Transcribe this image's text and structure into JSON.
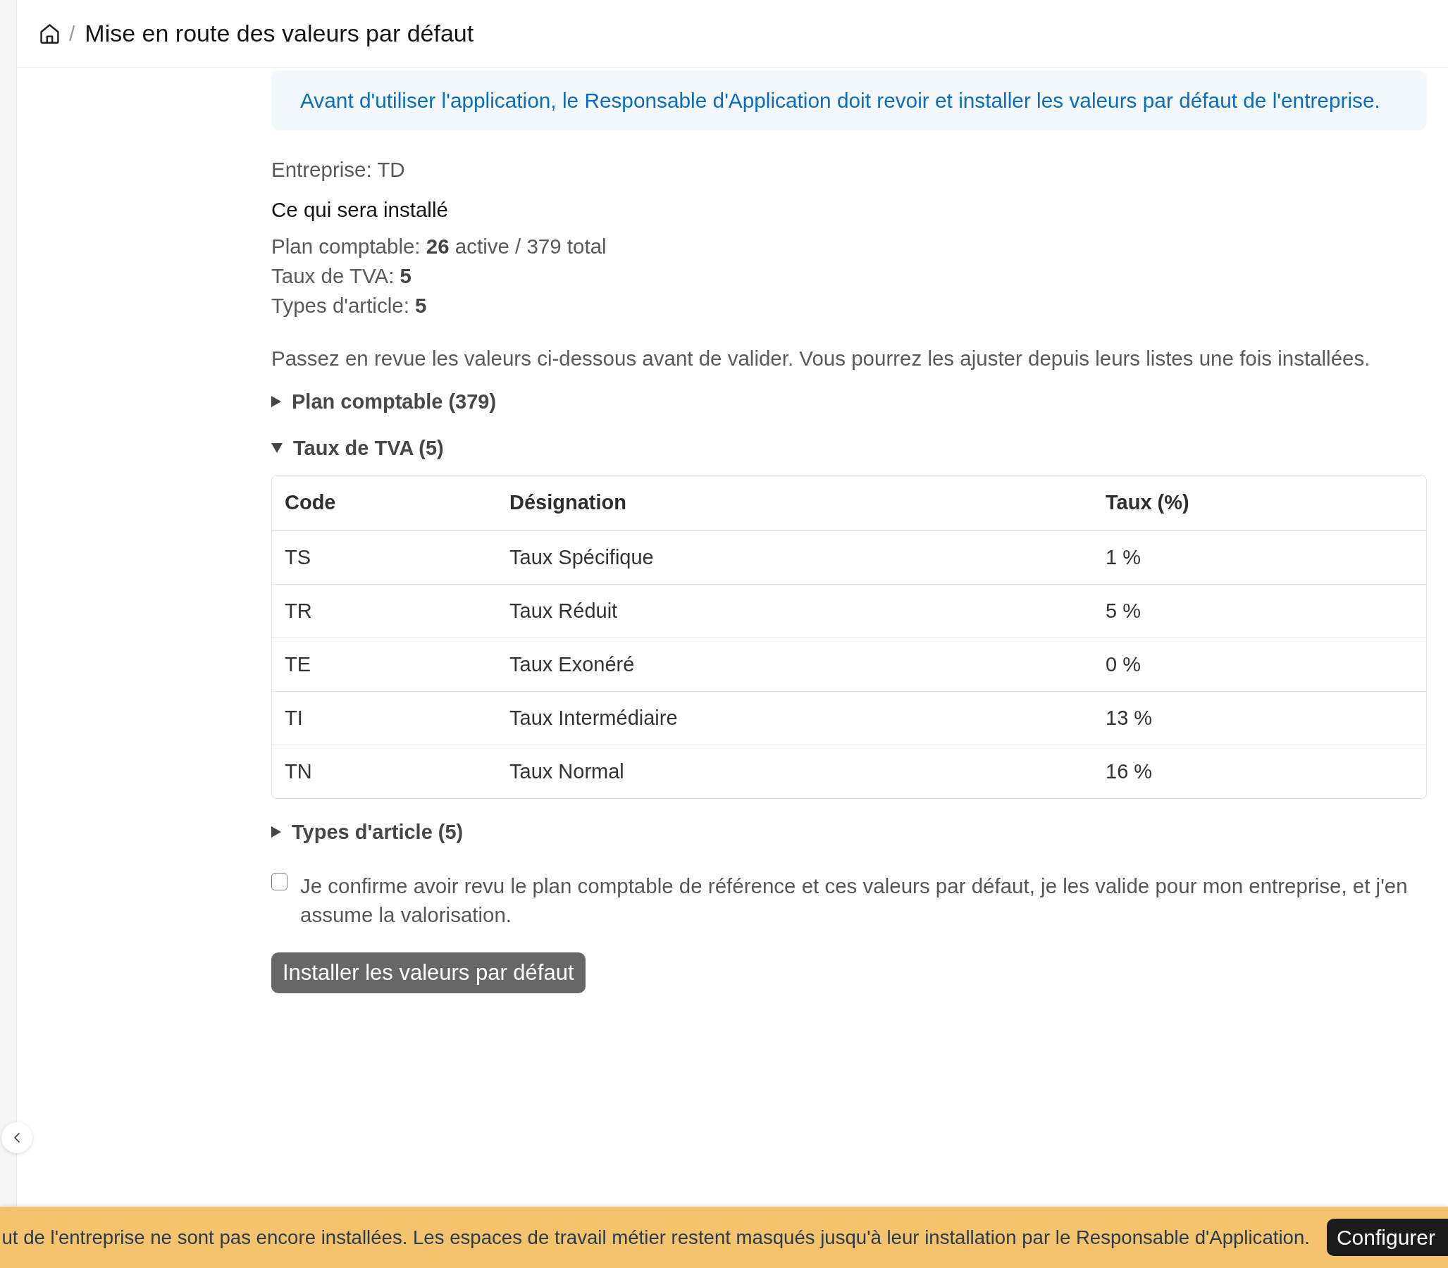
{
  "breadcrumb": {
    "separator": "/",
    "title": "Mise en route des valeurs par défaut"
  },
  "info_banner": {
    "text": "Avant d'utiliser l'application, le Responsable d'Application doit revoir et installer les valeurs par défaut de l'entreprise."
  },
  "company": "Entreprise: TD",
  "summary": {
    "heading": "Ce qui sera installé",
    "lines": [
      "Plan comptable: **26** active / 379 total",
      "Taux de TVA: **5**",
      "Types d'article: **5**"
    ]
  },
  "instructions": "Passez en revue les valeurs ci-dessous avant de valider. Vous pourrez les ajuster depuis leurs listes une fois installées.",
  "sections": [
    {
      "label": "Plan comptable (379)",
      "expanded": false
    },
    {
      "label": "Taux de TVA (5)",
      "expanded": true,
      "table": {
        "columns": [
          "Code",
          "Désignation",
          "Taux (%)"
        ],
        "rows": [
          [
            "TS",
            "Taux Spécifique",
            "1 %"
          ],
          [
            "TR",
            "Taux Réduit",
            "5 %"
          ],
          [
            "TE",
            "Taux Exonéré",
            "0 %"
          ],
          [
            "TI",
            "Taux Intermédiaire",
            "13 %"
          ],
          [
            "TN",
            "Taux Normal",
            "16 %"
          ]
        ]
      }
    },
    {
      "label": "Types d'article (5)",
      "expanded": false
    }
  ],
  "confirmation": {
    "label": "Je confirme avoir revu le plan comptable de référence et ces valeurs par défaut, je les valide pour mon entreprise, et j'en assume la valorisation.",
    "checked": false
  },
  "install_button": {
    "label": "Installer les valeurs par défaut",
    "disabled": true
  },
  "notice_bar": {
    "text": "ut de l'entreprise ne sont pas encore installées. Les espaces de travail métier restent masqués jusqu'à leur installation par le Responsable d'Application.",
    "button": "Configurer"
  }
}
